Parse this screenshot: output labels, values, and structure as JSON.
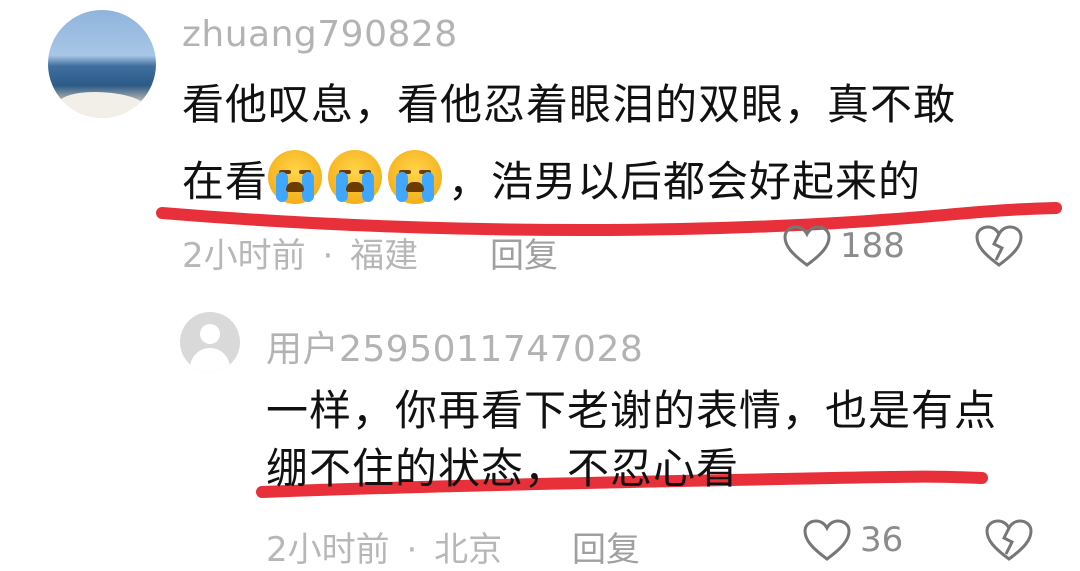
{
  "comments": [
    {
      "username": "zhuang790828",
      "line1": "看他叹息，看他忍着眼泪的双眼，真不敢",
      "line2_pre": "在看",
      "line2_post": "，浩男以后都会好起来的",
      "emoji": "crying-face-icon",
      "time": "2小时前",
      "location": "福建",
      "reply_label": "回复",
      "likes": "188"
    },
    {
      "username": "用户2595011747028",
      "line1": "一样，你再看下老谢的表情，也是有点",
      "line2": "绷不住的状态，不忍心看",
      "time": "2小时前",
      "location": "北京",
      "reply_label": "回复",
      "likes": "36"
    }
  ],
  "separator": "·",
  "colors": {
    "underline": "#e8303a",
    "meta": "#b7b7b7",
    "text": "#111111"
  }
}
